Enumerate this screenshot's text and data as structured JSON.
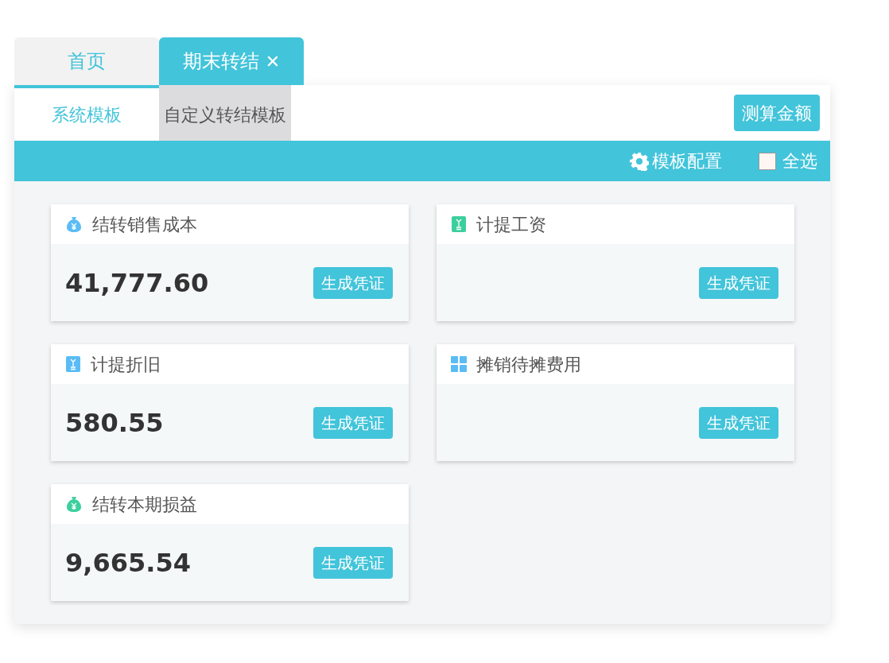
{
  "tabs": [
    {
      "label": "首页",
      "selected": false
    },
    {
      "label": "期末转结",
      "selected": true,
      "close": "✕"
    }
  ],
  "subtabs": [
    {
      "label": "系统模板",
      "selected": true
    },
    {
      "label": "自定义转结模板",
      "selected": false
    }
  ],
  "estimate_button": "测算金额",
  "toolbar": {
    "config": "模板配置",
    "select_all": {
      "label": "全选",
      "checked": false
    }
  },
  "cards": [
    {
      "title": "结转销售成本",
      "kind": "moneybag",
      "color": "#5bbcf5",
      "amount": "41,777.60",
      "button": "生成凭证"
    },
    {
      "title": "计提工资",
      "kind": "document",
      "color": "#3ccf9e",
      "button": "生成凭证"
    },
    {
      "title": "计提折旧",
      "kind": "document",
      "color": "#5bbcf5",
      "amount": "580.55",
      "button": "生成凭证"
    },
    {
      "title": "摊销待摊费用",
      "kind": "grid",
      "color": "#5bbcf5",
      "button": "生成凭证"
    },
    {
      "title": "结转本期损益",
      "kind": "moneybag",
      "color": "#3ccf9e",
      "amount": "9,665.54",
      "button": "生成凭证"
    }
  ]
}
